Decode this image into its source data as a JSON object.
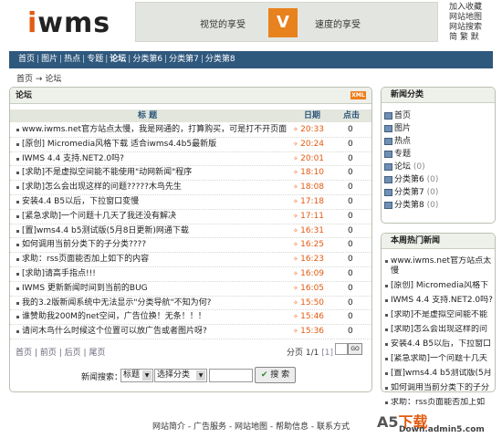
{
  "header": {
    "logo_prefix": "i",
    "logo_rest": "wms",
    "banner_left": "视觉的享受",
    "banner_mid": "V",
    "banner_right": "速度的享受",
    "toplinks": [
      "加入收藏",
      "网站地图",
      "网站搜索",
      "简 繁 默"
    ]
  },
  "nav": {
    "items": [
      "首页",
      "图片",
      "热点",
      "专题",
      "论坛",
      "分类第6",
      "分类第7",
      "分类第8"
    ],
    "separator": "|",
    "current_index": 4
  },
  "breadcrumb": {
    "home": "首页",
    "arrow": "→",
    "current": "论坛"
  },
  "main": {
    "title": "论坛",
    "xml_badge": "XML",
    "columns": {
      "title": "标 题",
      "date": "日期",
      "clicks": "点击"
    },
    "rows": [
      {
        "title": "www.iwms.net官方站点太慢，我是网通的，打算购买，可是打不开页面",
        "date": "20:33",
        "clicks": "0"
      },
      {
        "title": "[原创] Micromedia风格下载 适合iwms4.4b5最新版",
        "date": "20:24",
        "clicks": "0"
      },
      {
        "title": "IWMS 4.4 支持.NET2.0吗?",
        "date": "20:01",
        "clicks": "0"
      },
      {
        "title": "[求助]不是虚拟空间能不能使用\"动网新闻\"程序",
        "date": "18:10",
        "clicks": "0"
      },
      {
        "title": "[求助]怎么会出现这样的问题?????木鸟先生",
        "date": "18:08",
        "clicks": "0"
      },
      {
        "title": "安装4.4 B5以后，下拉窗口变慢",
        "date": "17:18",
        "clicks": "0"
      },
      {
        "title": "[紧急求助]一个问题十几天了我还没有解决",
        "date": "17:11",
        "clicks": "0"
      },
      {
        "title": "[置]wms4.4 b5测试版(5月8日更新)网通下载",
        "date": "16:31",
        "clicks": "0"
      },
      {
        "title": "如何调用当前分类下的子分类????",
        "date": "16:25",
        "clicks": "0"
      },
      {
        "title": "求助：rss页面能否加上如下的内容",
        "date": "16:23",
        "clicks": "0"
      },
      {
        "title": "[求助]请高手指点!!!",
        "date": "16:09",
        "clicks": "0"
      },
      {
        "title": "IWMS 更新新闻时间到当前的BUG",
        "date": "16:05",
        "clicks": "0"
      },
      {
        "title": "我的3.2版新闻系统中无法显示\"分类导航\"不知为何?",
        "date": "15:50",
        "clicks": "0"
      },
      {
        "title": "谁赞助我200M的net空间，广告位换！无条！！！",
        "date": "15:46",
        "clicks": "0"
      },
      {
        "title": "请问木鸟什么时候这个位置可以放广告或者图片呀?",
        "date": "15:36",
        "clicks": "0"
      }
    ],
    "pager": {
      "first": "首页",
      "prev": "前页",
      "next": "后页",
      "last": "尾页",
      "sep": "|",
      "info_label": "分页",
      "info_value": "1/1",
      "current_page": "[1]",
      "go": "GO"
    },
    "search": {
      "label": "新闻搜索：",
      "field_select": "标题",
      "category_select": "选择分类",
      "button": "搜 索",
      "query": ""
    }
  },
  "news_categories": {
    "title": "新闻分类",
    "items": [
      {
        "label": "首页",
        "count": ""
      },
      {
        "label": "图片",
        "count": ""
      },
      {
        "label": "热点",
        "count": ""
      },
      {
        "label": "专题",
        "count": ""
      },
      {
        "label": "论坛",
        "count": "(0)"
      },
      {
        "label": "分类第6",
        "count": "(0)"
      },
      {
        "label": "分类第7",
        "count": "(0)"
      },
      {
        "label": "分类第8",
        "count": "(0)"
      }
    ]
  },
  "hot_news": {
    "title": "本周热门新闻",
    "items": [
      "www.iwms.net官方站点太慢",
      "[原创] Micromedia风格下",
      "IWMS 4.4 支持.NET2.0吗?",
      "[求助]不是虚拟空间能不能",
      "[求助]怎么会出现这样的问",
      "安装4.4 B5以后，下拉窗口",
      "[紧急求助]一个问题十几天",
      "[置]wms4.4 b5测试版(5月",
      "如何调用当前分类下的子分",
      "求助：rss页面能否加上如"
    ]
  },
  "footer": {
    "links": [
      "网站简介",
      "广告服务",
      "网站地图",
      "帮助信息",
      "联系方式"
    ],
    "sep": " - "
  },
  "watermark": {
    "brand": "A5",
    "suffix": "下载",
    "domain": "Down.admin5.com"
  },
  "colors": {
    "nav": "#2f587d",
    "accent": "#e25a10",
    "panel_border": "#b9c1b1",
    "header_bg": "#e2e6dc"
  }
}
